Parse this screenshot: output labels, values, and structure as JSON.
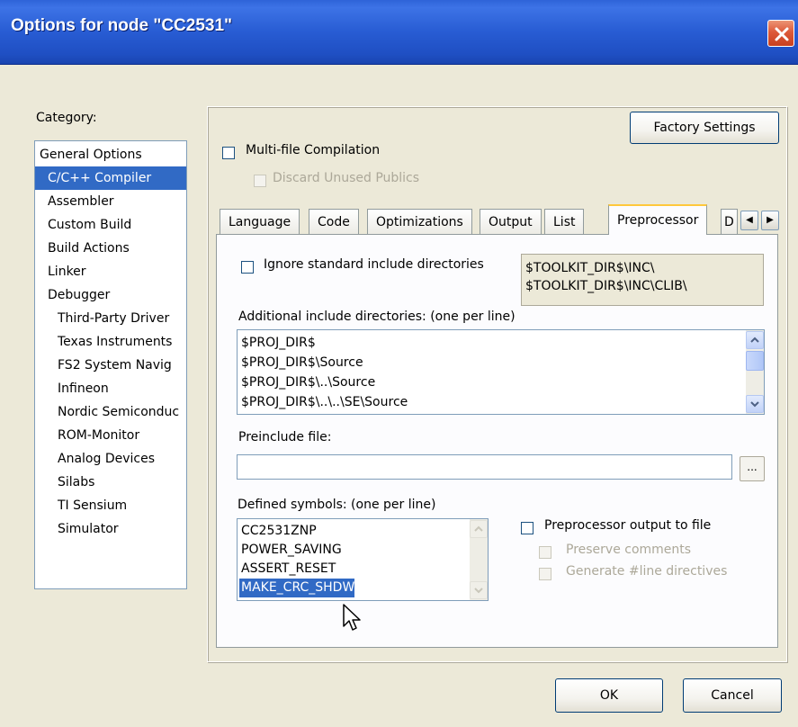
{
  "window": {
    "title": "Options for node \"CC2531\""
  },
  "category": {
    "label": "Category:",
    "items": [
      "General Options",
      "C/C++ Compiler",
      "Assembler",
      "Custom Build",
      "Build Actions",
      "Linker",
      "Debugger",
      "Third-Party Driver",
      "Texas Instruments",
      "FS2 System Navig",
      "Infineon",
      "Nordic Semiconduc",
      "ROM-Monitor",
      "Analog Devices",
      "Silabs",
      "TI Sensium",
      "Simulator"
    ],
    "selected": "C/C++ Compiler"
  },
  "options": {
    "factory_settings": "Factory Settings",
    "multifile_label": "Multi-file Compilation",
    "discard_label": "Discard Unused Publics"
  },
  "tabs": {
    "items": [
      "Language",
      "Code",
      "Optimizations",
      "Output",
      "List",
      "Preprocessor",
      "D"
    ],
    "active": "Preprocessor"
  },
  "preprocessor": {
    "ignore_std_label": "Ignore standard include directories",
    "std_include_dirs": [
      "$TOOLKIT_DIR$\\INC\\",
      "$TOOLKIT_DIR$\\INC\\CLIB\\"
    ],
    "additional_label": "Additional include directories: (one per line)",
    "additional_dirs": [
      "$PROJ_DIR$",
      "$PROJ_DIR$\\Source",
      "$PROJ_DIR$\\..\\Source",
      "$PROJ_DIR$\\..\\..\\SE\\Source"
    ],
    "preinclude_label": "Preinclude file:",
    "preinclude_value": "",
    "browse_label": "...",
    "defined_label": "Defined symbols: (one per line)",
    "defined_symbols": [
      "CC2531ZNP",
      "POWER_SAVING",
      "ASSERT_RESET",
      "MAKE_CRC_SHDW"
    ],
    "selected_symbol": "MAKE_CRC_SHDW",
    "pp_output_label": "Preprocessor output to file",
    "preserve_comments_label": "Preserve comments",
    "generate_line_label": "Generate #line directives"
  },
  "footer": {
    "ok": "OK",
    "cancel": "Cancel"
  },
  "colors": {
    "titlebar": "#285cd3",
    "selection": "#316ac5",
    "dialog_bg": "#ece9d8"
  }
}
